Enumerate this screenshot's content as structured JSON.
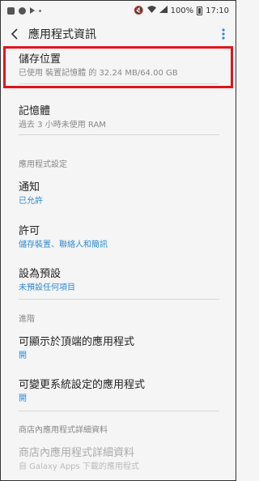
{
  "status_bar": {
    "battery": "100%",
    "time": "17:10"
  },
  "app_bar": {
    "title": "應用程式資訊"
  },
  "storage": {
    "title": "儲存位置",
    "subtitle": "已使用 裝置記憶體 的 32.24 MB/64.00 GB"
  },
  "memory": {
    "title": "記憶體",
    "subtitle": "過去 3 小時未使用 RAM"
  },
  "sections": {
    "app_settings": "應用程式設定",
    "advanced": "進階",
    "store": "商店內應用程式詳細資料"
  },
  "notifications": {
    "title": "通知",
    "subtitle": "已允許"
  },
  "permissions": {
    "title": "許可",
    "subtitle": "儲存裝置、聯絡人和簡訊"
  },
  "set_default": {
    "title": "設為預設",
    "subtitle": "未預設任何項目"
  },
  "draw_over": {
    "title": "可顯示於頂端的應用程式",
    "subtitle": "開"
  },
  "modify_settings": {
    "title": "可變更系統設定的應用程式",
    "subtitle": "開"
  },
  "store_details": {
    "title": "商店內應用程式詳細資料",
    "subtitle": "自 Galaxy Apps 下載的應用程式"
  },
  "colors": {
    "accent": "#2c8ad5",
    "highlight": "#e0151b"
  }
}
